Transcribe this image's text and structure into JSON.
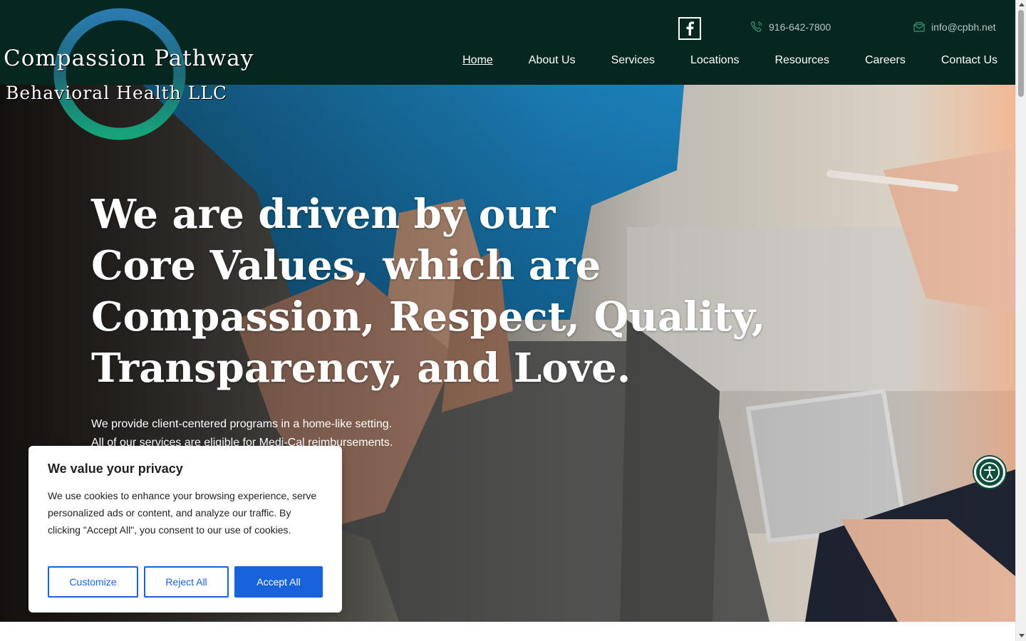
{
  "header": {
    "logo": {
      "line1": "Compassion Pathway",
      "line2": "Behavioral Health LLC"
    },
    "social": {
      "icon": "facebook-icon"
    },
    "contact": {
      "phone": {
        "icon": "phone-icon",
        "text": "916-642-7800"
      },
      "email": {
        "icon": "envelope-icon",
        "text": "info@cpbh.net"
      }
    },
    "nav": [
      {
        "label": "Home",
        "active": true
      },
      {
        "label": "About Us"
      },
      {
        "label": "Services"
      },
      {
        "label": "Locations"
      },
      {
        "label": "Resources"
      },
      {
        "label": "Careers"
      },
      {
        "label": "Contact Us"
      }
    ]
  },
  "hero": {
    "title_lines": [
      "We are driven by our",
      "Core Values, which are",
      "Compassion, Respect, Quality,",
      "Transparency, and Love."
    ],
    "subtitle_lines": [
      "We provide client-centered programs in a home-like setting.",
      "All of our services are eligible for Medi-Cal reimbursements."
    ]
  },
  "cookie_banner": {
    "title": "We value your privacy",
    "text": "We use cookies to enhance your browsing experience, serve personalized ads or content, and analyze our traffic. By clicking \"Accept All\", you consent to our use of cookies.",
    "buttons": {
      "customize": "Customize",
      "reject": "Reject All",
      "accept": "Accept All"
    }
  },
  "accessibility": {
    "icon": "accessibility-icon"
  },
  "colors": {
    "header_bg": "#062620",
    "brand_button": "#1863dc",
    "accessibility_bg": "#0f4e3b",
    "logo_ring_top": "#2a7ab0",
    "logo_ring_bottom": "#17a37a"
  }
}
